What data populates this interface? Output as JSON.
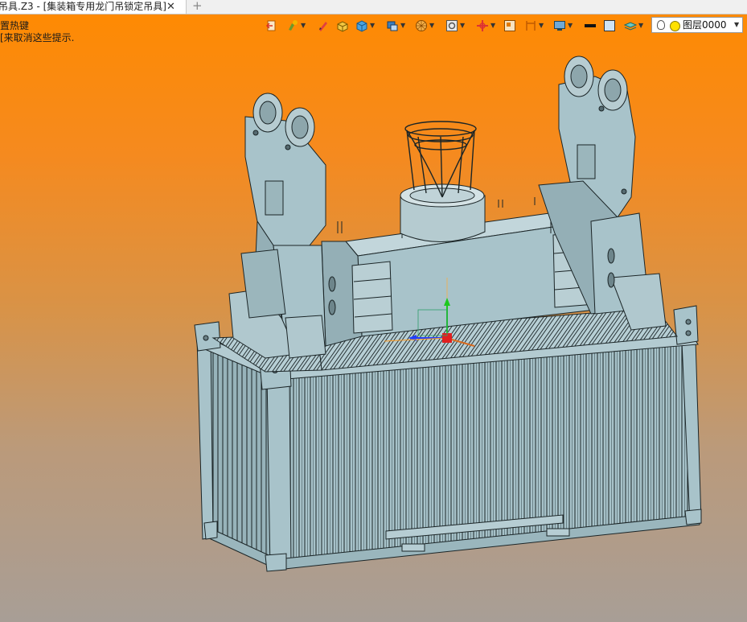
{
  "tab": {
    "title": "吊具.Z3 - [集装箱专用龙门吊锁定吊具]",
    "close_glyph": "✕",
    "new_tab_glyph": "+"
  },
  "prompt": {
    "line1": "置热键",
    "line2": "[来取消这些提示."
  },
  "layer": {
    "name": "图层0000"
  },
  "toolbar_icons": [
    "exit-icon",
    "paint-icon",
    "pen-icon",
    "solid-icon",
    "cube-icon",
    "view-cube-icon",
    "render-sphere-icon",
    "zoom-fit-icon",
    "pan-icon",
    "frame-icon",
    "section-icon",
    "display-icon",
    "line-color-icon",
    "fill-color-icon",
    "layer-stack-icon"
  ],
  "colors": {
    "model_fill": "#a8c3ca",
    "model_stroke": "#1b2527",
    "bg_top": "#ff8a00",
    "bg_bottom": "#a89e96"
  }
}
